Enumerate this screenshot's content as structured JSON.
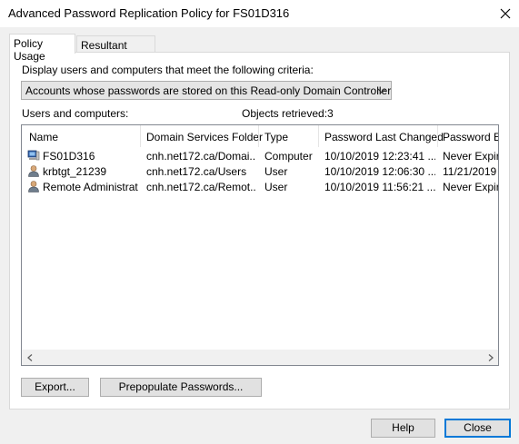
{
  "window": {
    "title": "Advanced Password Replication Policy for FS01D316"
  },
  "tabs": [
    {
      "label": "Policy Usage",
      "active": true
    },
    {
      "label": "Resultant Policy",
      "active": false
    }
  ],
  "criteria": {
    "label": "Display users and computers that meet the following criteria:",
    "selected": "Accounts whose passwords are stored on this Read-only Domain Controller"
  },
  "list": {
    "label": "Users and computers:",
    "objects_label": "Objects retrieved:",
    "objects_count": "3",
    "columns": [
      "Name",
      "Domain Services Folder",
      "Type",
      "Password Last Changed",
      "Password Ex"
    ],
    "rows": [
      {
        "icon": "computer-icon",
        "name": "FS01D316",
        "folder": "cnh.net172.ca/Domai...",
        "type": "Computer",
        "changed": "10/10/2019 12:23:41 ...",
        "expires": "Never Expire"
      },
      {
        "icon": "user-icon",
        "name": "krbtgt_21239",
        "folder": "cnh.net172.ca/Users",
        "type": "User",
        "changed": "10/10/2019 12:06:30 ...",
        "expires": "11/21/2019"
      },
      {
        "icon": "user-icon",
        "name": "Remote Administrator",
        "folder": "cnh.net172.ca/Remot...",
        "type": "User",
        "changed": "10/10/2019 11:56:21 ...",
        "expires": "Never Expire"
      }
    ]
  },
  "buttons": {
    "export": "Export...",
    "prepopulate": "Prepopulate Passwords...",
    "help": "Help",
    "close": "Close"
  },
  "colors": {
    "focus": "#0078d7",
    "dialog_bg": "#f0f0f0"
  }
}
